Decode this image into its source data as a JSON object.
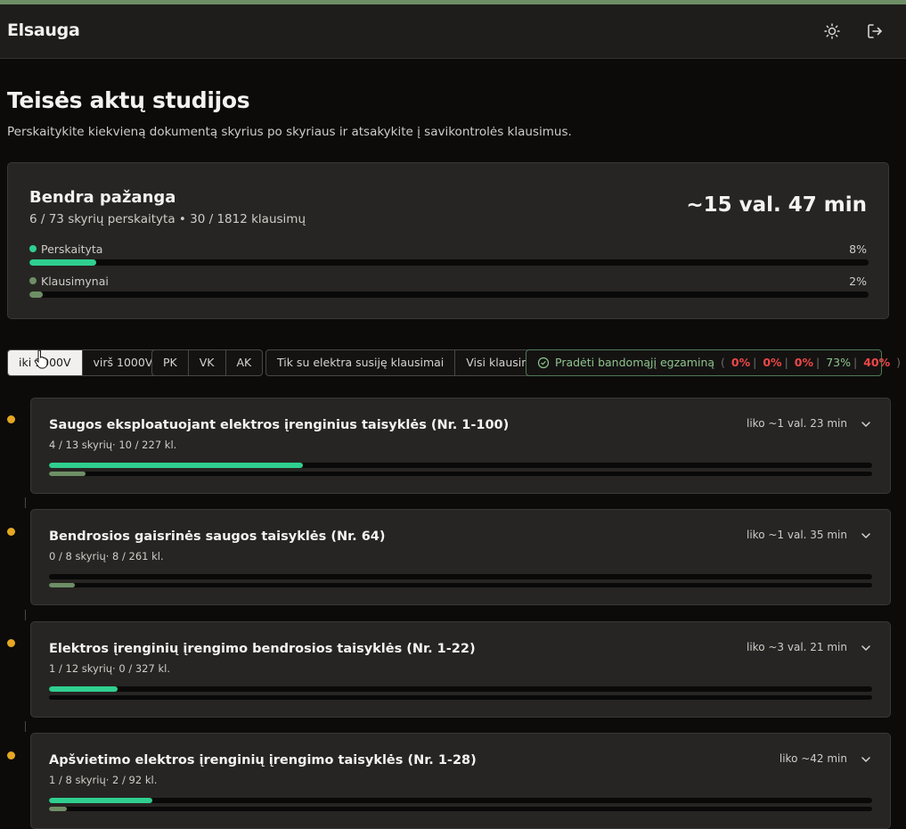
{
  "app": {
    "title": "Elsauga",
    "icons": [
      "sun-icon",
      "logout-icon"
    ]
  },
  "page": {
    "title": "Teisės aktų studijos",
    "subtitle": "Perskaitykite kiekvieną dokumentą skyrius po skyriaus ir atsakykite į savikontrolės klausimus."
  },
  "overall": {
    "title": "Bendra pažanga",
    "stats": "6 / 73 skyrių perskaityta • 30 / 1812 klausimų",
    "time": "~15 val. 47 min",
    "read_label": "Perskaityta",
    "read_pct": "8%",
    "read_progress": 0.08,
    "quiz_label": "Klausimynai",
    "quiz_pct": "2%",
    "quiz_progress": 0.016
  },
  "filters": {
    "voltage": [
      {
        "label": "iki 1000V",
        "active": true
      },
      {
        "label": "virš 1000V",
        "active": false
      }
    ],
    "group": [
      "PK",
      "VK",
      "AK"
    ],
    "questions": [
      "Tik su elektra susiję klausimai",
      "Visi klausimai"
    ],
    "exam": {
      "label": "Pradėti bandomąjį egzaminą",
      "open": "(",
      "close": ")",
      "scores": [
        {
          "value": "0%",
          "status": "fail"
        },
        {
          "value": "0%",
          "status": "fail"
        },
        {
          "value": "0%",
          "status": "fail"
        },
        {
          "value": "73%",
          "status": "pass"
        },
        {
          "value": "40%",
          "status": "fail"
        }
      ]
    }
  },
  "chapters": [
    {
      "title": "Saugos eksploatuojant elektros įrenginius taisyklės (Nr. 1-100)",
      "meta": "4 / 13 skyrių· 10 / 227 kl.",
      "remaining": "liko ~1 val. 23 min",
      "read_progress": 0.308,
      "quiz_progress": 0.044
    },
    {
      "title": "Bendrosios gaisrinės saugos taisyklės (Nr. 64)",
      "meta": "0 / 8 skyrių· 8 / 261 kl.",
      "remaining": "liko ~1 val. 35 min",
      "read_progress": 0.0,
      "quiz_progress": 0.031
    },
    {
      "title": "Elektros įrenginių įrengimo bendrosios taisyklės (Nr. 1-22)",
      "meta": "1 / 12 skyrių· 0 / 327 kl.",
      "remaining": "liko ~3 val. 21 min",
      "read_progress": 0.083,
      "quiz_progress": 0.0
    },
    {
      "title": "Apšvietimo elektros įrenginių įrengimo taisyklės (Nr. 1-28)",
      "meta": "1 / 8 skyrių· 2 / 92 kl.",
      "remaining": "liko ~42 min",
      "read_progress": 0.125,
      "quiz_progress": 0.022
    }
  ],
  "colors": {
    "accent": "#2fcf8f",
    "quiz": "#6e8f66",
    "bullet": "#e5a722",
    "fail": "#f04747",
    "pass": "#8fc48e"
  }
}
